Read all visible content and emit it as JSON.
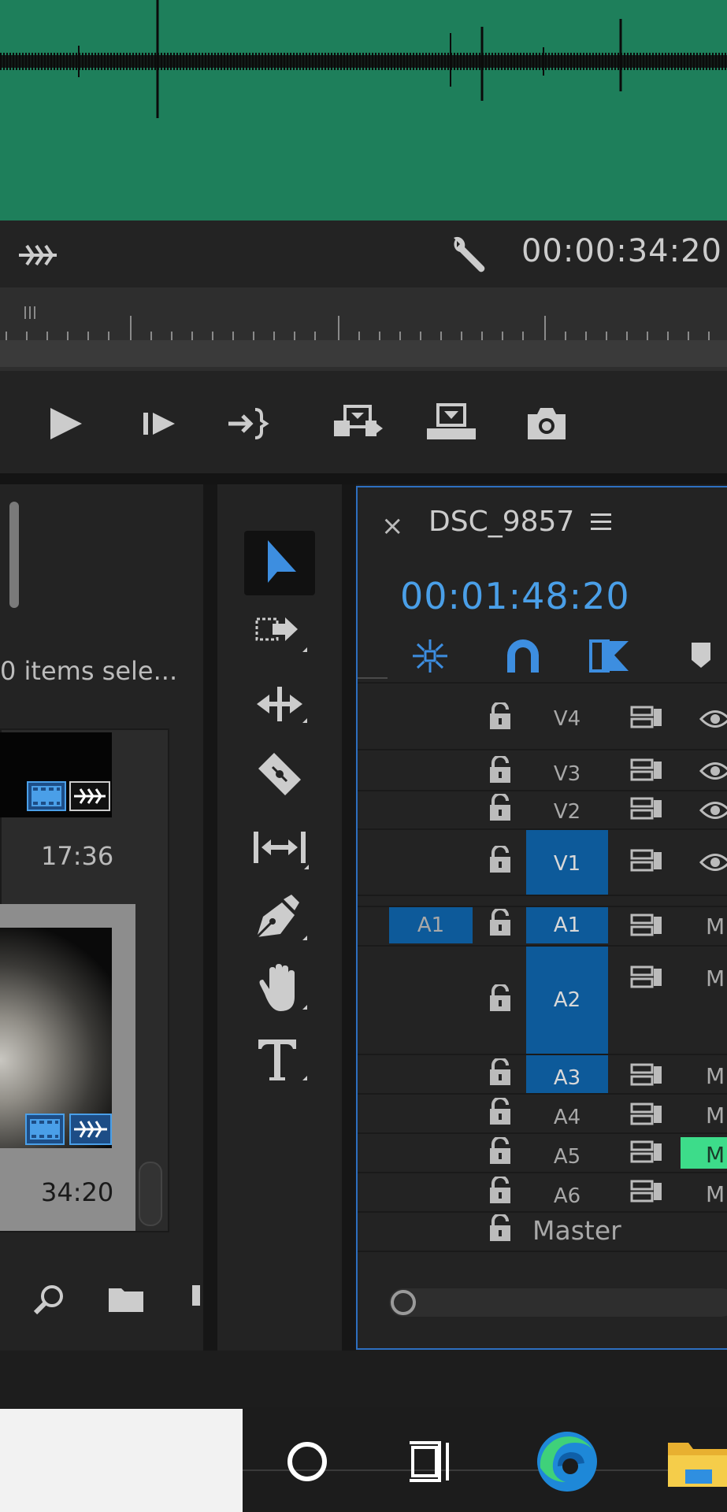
{
  "source_monitor": {
    "timecode": "00:00:34:20"
  },
  "project": {
    "items_selected": "0 items sele...",
    "thumbnails": [
      {
        "duration": "17:36"
      },
      {
        "duration": "34:20"
      }
    ]
  },
  "sequence": {
    "name": "DSC_9857",
    "close_label": "×",
    "timecode": "00:01:48:20"
  },
  "tracks": {
    "video": [
      "V4",
      "V3",
      "V2",
      "V1"
    ],
    "audio": [
      "A1",
      "A2",
      "A3",
      "A4",
      "A5",
      "A6"
    ],
    "source_patch": "A1",
    "master": "Master",
    "mute_label": "M"
  },
  "colors": {
    "waveform_bg": "#1e7f5b",
    "accent_blue": "#4a9fe8",
    "target_blue": "#0d5a9a",
    "solo_green": "#3ddc8a",
    "panel_border": "#2d6fc0"
  },
  "tools": [
    "selection-tool",
    "track-select-forward-tool",
    "ripple-edit-tool",
    "razor-tool",
    "slip-tool",
    "pen-tool",
    "hand-tool",
    "type-tool"
  ],
  "taskbar": {
    "icons": [
      "cortana-icon",
      "task-view-icon",
      "edge-icon",
      "file-explorer-icon"
    ]
  }
}
